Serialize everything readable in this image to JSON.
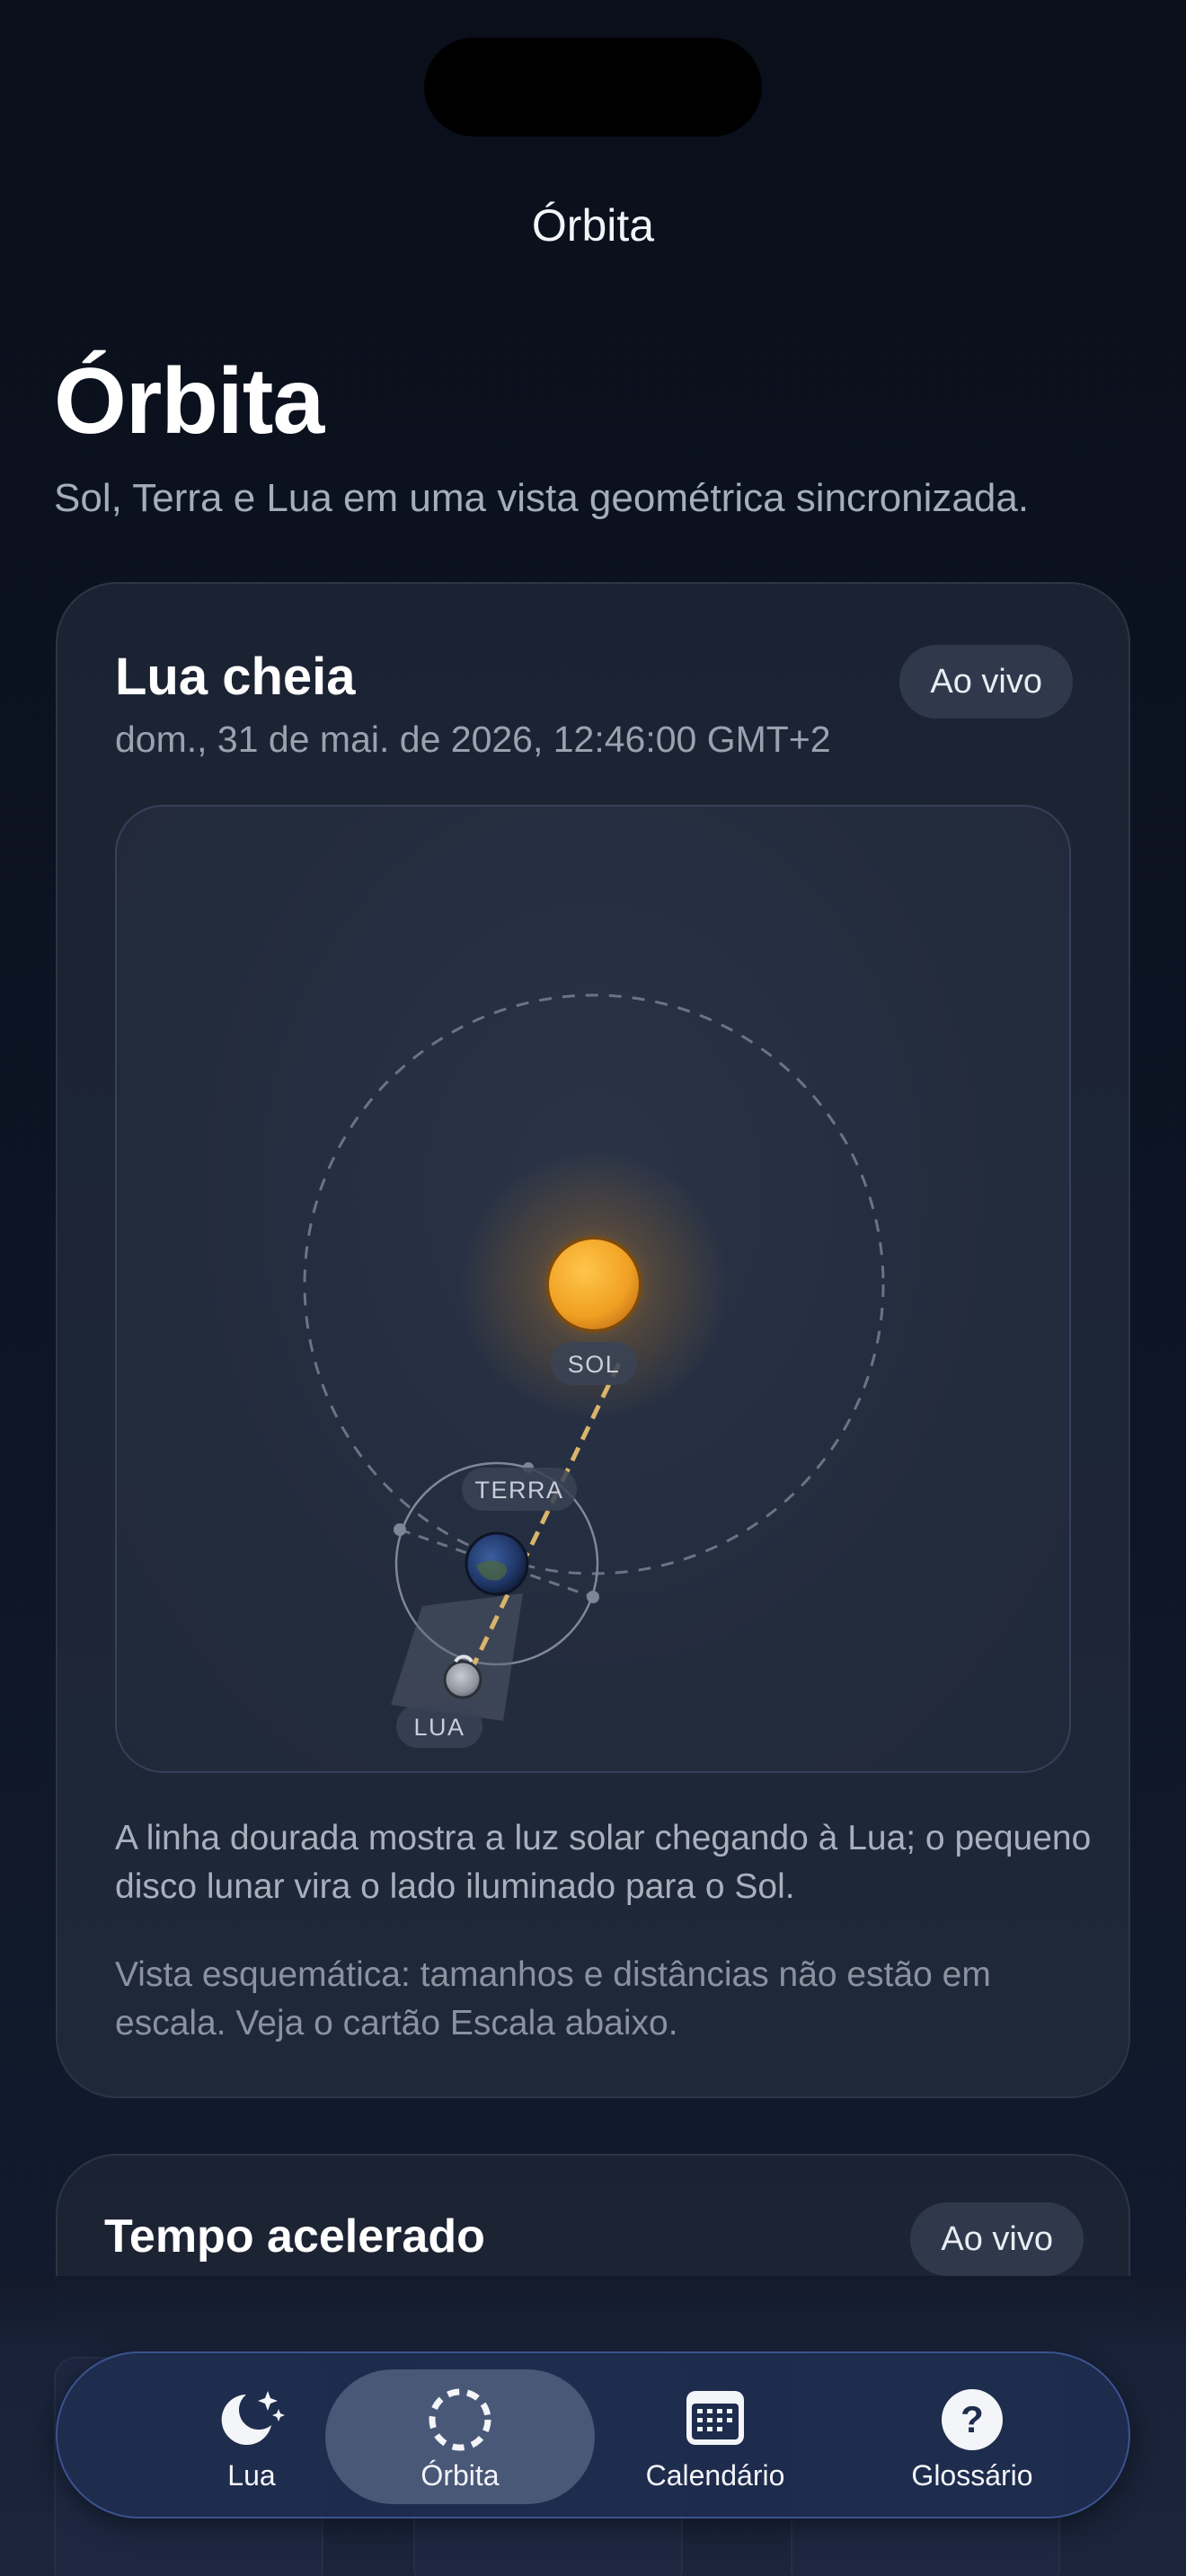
{
  "nav": {
    "title": "Órbita"
  },
  "header": {
    "large_title": "Órbita",
    "subtitle": "Sol, Terra e Lua em uma vista geométrica sincronizada."
  },
  "phase_card": {
    "title": "Lua cheia",
    "datetime": "dom., 31 de mai. de 2026, 12:46:00 GMT+2",
    "live_badge": "Ao vivo",
    "labels": {
      "sun": "SOL",
      "earth": "TERRA",
      "moon": "LUA"
    },
    "description": "A linha dourada mostra a luz solar chegando à Lua; o pequeno disco lunar vira o lado iluminado para o Sol.",
    "note": "Vista esquemática: tamanhos e distâncias não estão em escala. Veja o cartão Escala abaixo."
  },
  "time_card": {
    "title": "Tempo acelerado",
    "live_badge": "Ao vivo"
  },
  "tabbar": {
    "tabs": [
      {
        "label": "Lua",
        "icon": "moon-stars-icon",
        "active": false
      },
      {
        "label": "Órbita",
        "icon": "orbit-icon",
        "active": true
      },
      {
        "label": "Calendário",
        "icon": "calendar-icon",
        "active": false
      },
      {
        "label": "Glossário",
        "icon": "question-icon",
        "active": false
      }
    ]
  },
  "colors": {
    "accent_gold": "#d9b46a",
    "sun": "#f2a52a",
    "tab_active": "#4a5878"
  }
}
